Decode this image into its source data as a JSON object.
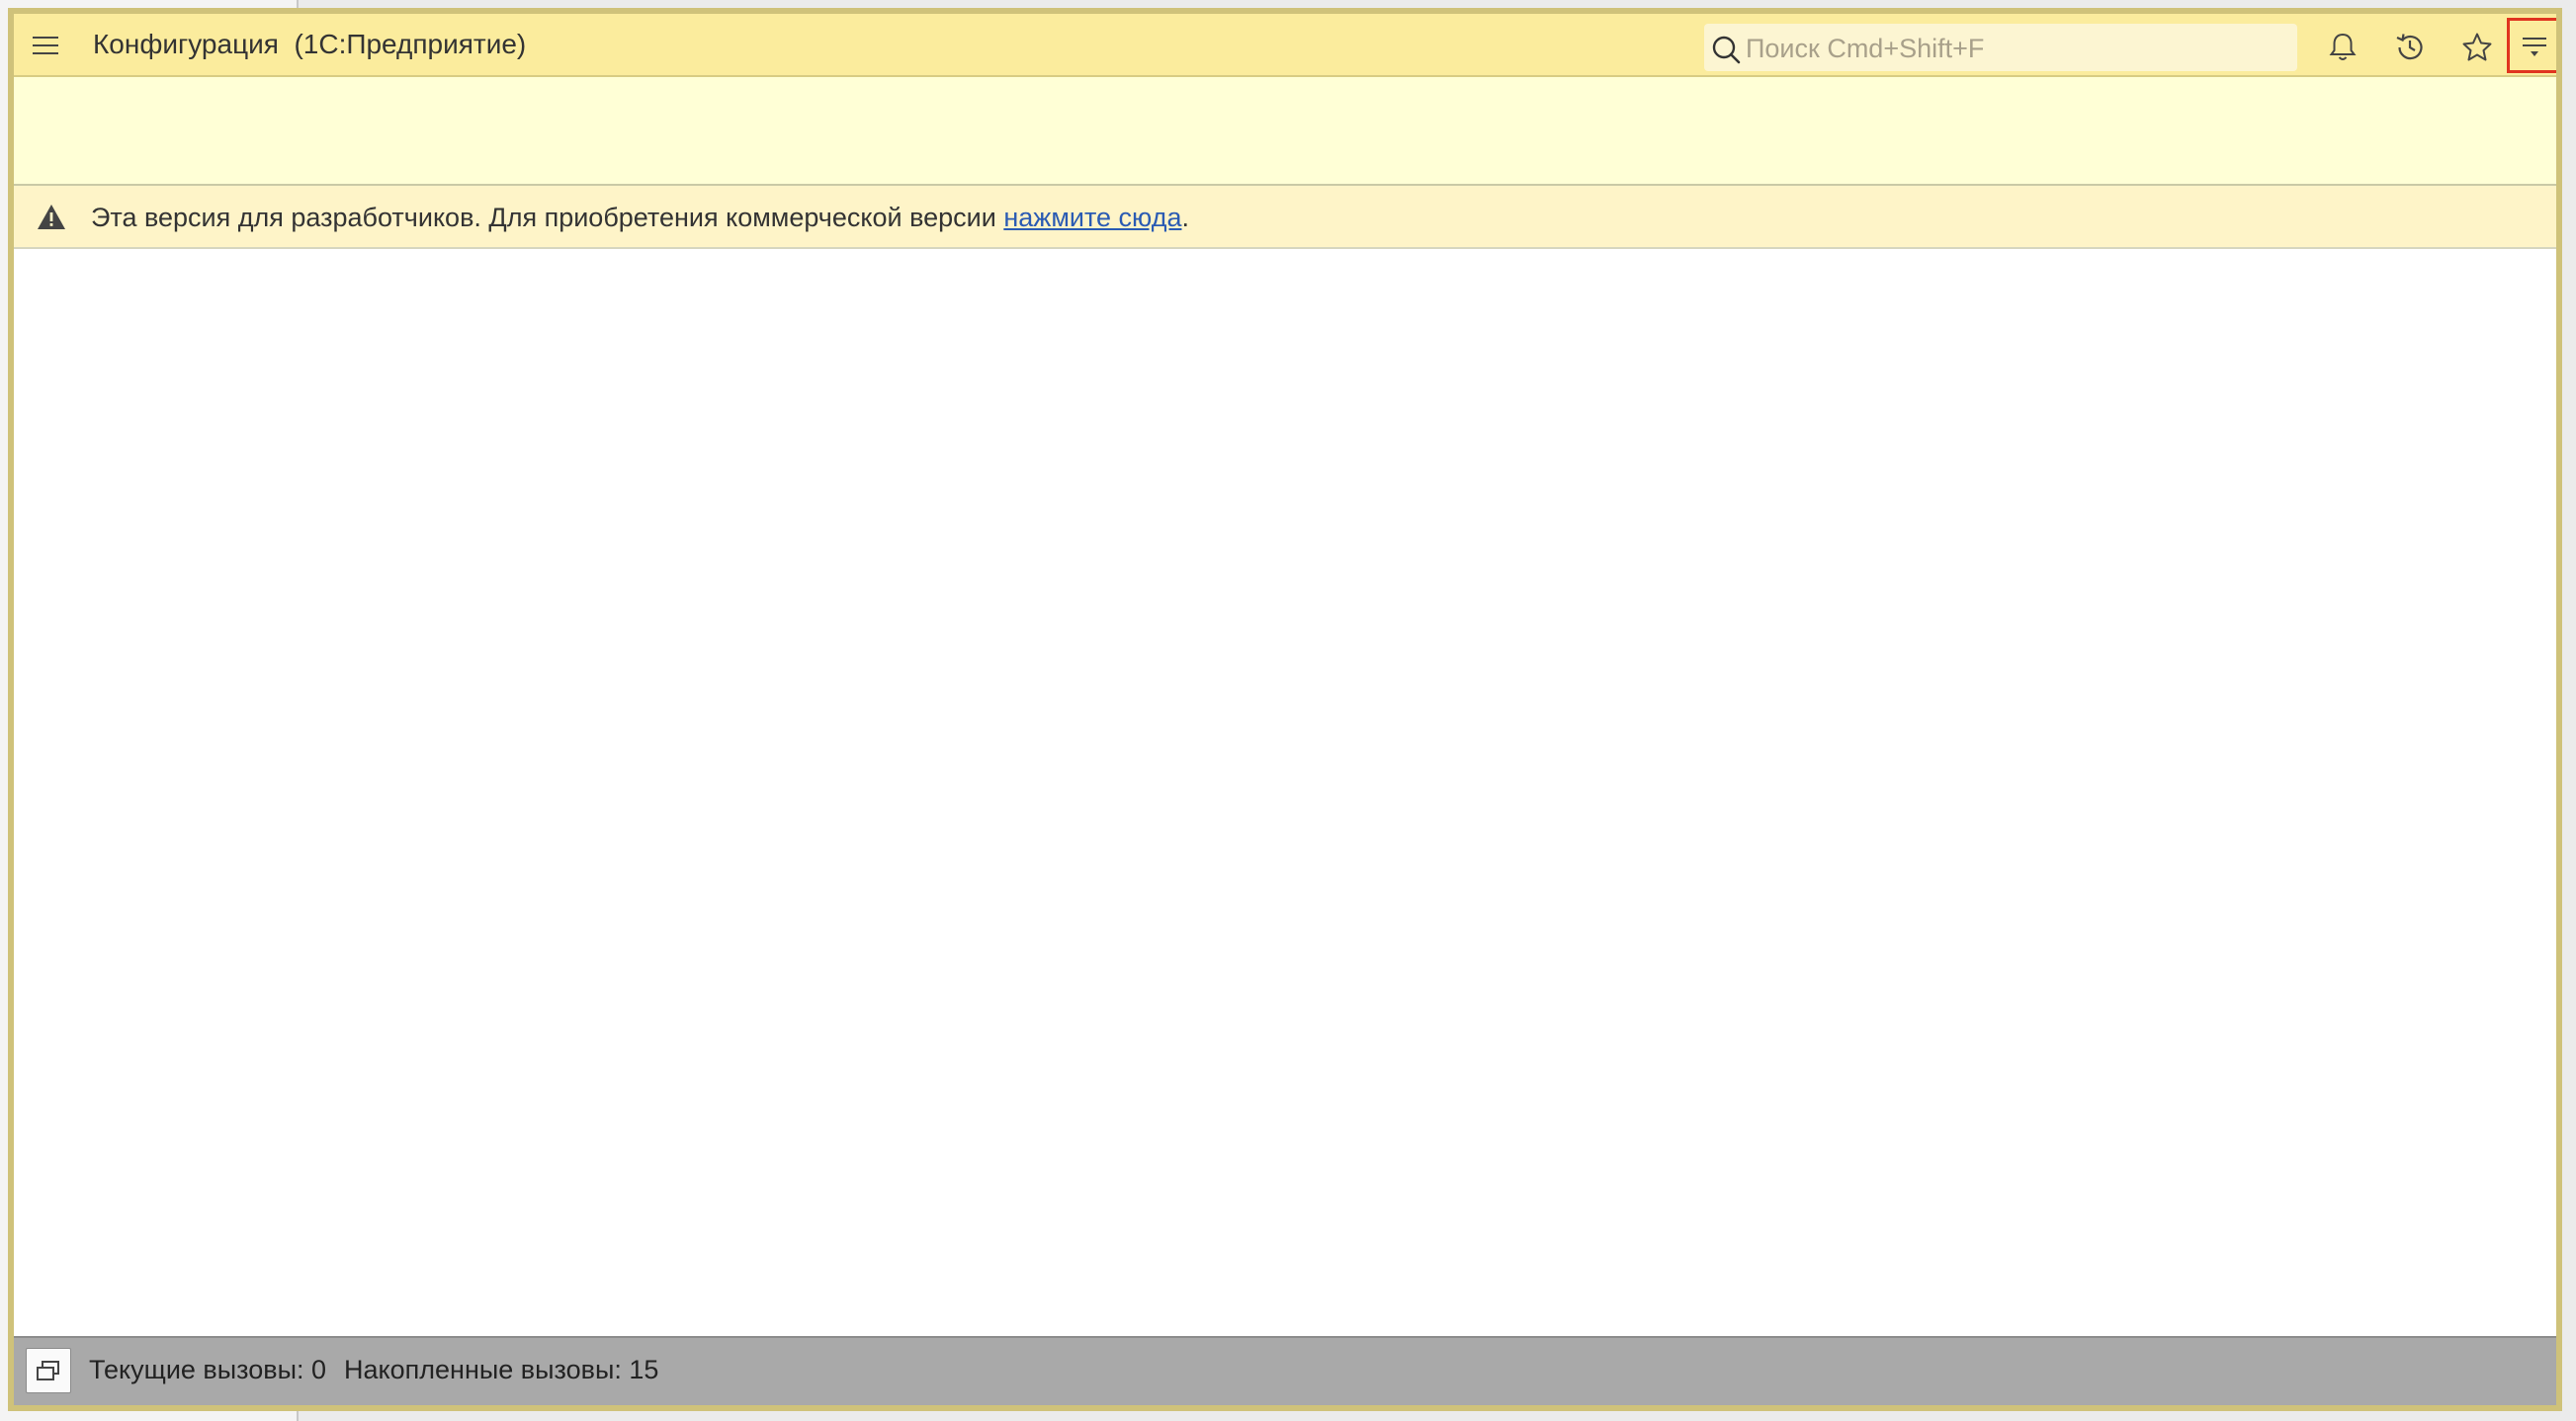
{
  "window": {
    "title": "Конфигурация  (1С:Предприятие)"
  },
  "search": {
    "placeholder": "Поиск Cmd+Shift+F",
    "value": ""
  },
  "toolbar": {
    "icons": [
      "bell-icon",
      "history-icon",
      "star-icon",
      "more-menu-icon"
    ]
  },
  "notice": {
    "text": "Эта версия для разработчиков. Для приобретения коммерческой версии ",
    "link": "нажмите сюда",
    "suffix": "."
  },
  "status": {
    "current_calls": "Текущие вызовы: 0",
    "accumulated_calls": "Накопленные вызовы: 15"
  },
  "colors": {
    "titlebar": "#fbec9d",
    "panel": "#ffffd6",
    "notice": "#fef4c8",
    "statusbar": "#a9a9a9",
    "highlight": "#e0341f",
    "link": "#2a5bb3"
  }
}
